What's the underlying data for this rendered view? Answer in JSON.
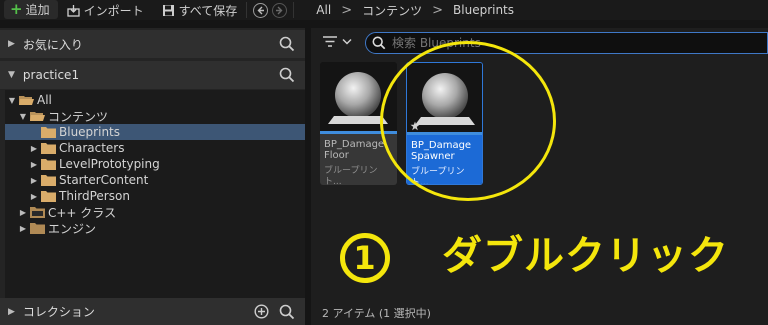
{
  "toolbar": {
    "add_label": "追加",
    "import_label": "インポート",
    "save_all_label": "すべて保存"
  },
  "breadcrumb": [
    "All",
    "コンテンツ",
    "Blueprints"
  ],
  "favorites": {
    "label": "お気に入り"
  },
  "project": {
    "label": "practice1"
  },
  "tree": [
    {
      "label": "All",
      "indent": 0,
      "expanded": true
    },
    {
      "label": "コンテンツ",
      "indent": 1,
      "expanded": true
    },
    {
      "label": "Blueprints",
      "indent": 2,
      "selected": true
    },
    {
      "label": "Characters",
      "indent": 2
    },
    {
      "label": "LevelPrototyping",
      "indent": 2
    },
    {
      "label": "StarterContent",
      "indent": 2
    },
    {
      "label": "ThirdPerson",
      "indent": 2
    },
    {
      "label": "C++ クラス",
      "indent": 1
    },
    {
      "label": "エンジン",
      "indent": 1
    }
  ],
  "collections": {
    "label": "コレクション"
  },
  "search": {
    "placeholder": "検索 Blueprints"
  },
  "assets": [
    {
      "name_line1": "BP_Damage",
      "name_line2": "Floor",
      "type": "ブループリント..."
    },
    {
      "name_line1": "BP_Damage",
      "name_line2": "Spawner",
      "type": "ブループリント..."
    }
  ],
  "status": "2 アイテム (1 選択中)",
  "annotation": {
    "number": "1",
    "text": "ダブルクリック"
  },
  "colors": {
    "selection": "#1c6ad6",
    "accent_line": "#3f8ddd",
    "annotation": "#f4e60c"
  }
}
